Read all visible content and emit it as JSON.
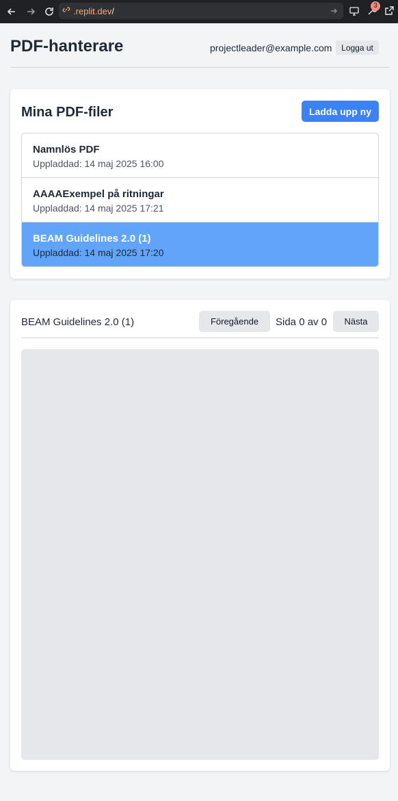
{
  "browser": {
    "url_domain": ".replit.dev",
    "url_path": "/",
    "extensions_badge": "3",
    "icons": [
      "back-arrow-icon",
      "forward-arrow-icon",
      "reload-icon",
      "link-icon",
      "go-arrow-icon",
      "monitor-icon",
      "wrench-icon",
      "external-link-icon"
    ]
  },
  "header": {
    "title": "PDF-hanterare",
    "user_email": "projectleader@example.com",
    "logout_label": "Logga ut"
  },
  "files_card": {
    "title": "Mina PDF-filer",
    "upload_label": "Ladda upp ny",
    "files": [
      {
        "name": "Namnlös PDF",
        "uploaded": "Uppladdad: 14 maj 2025 16:00",
        "selected": false
      },
      {
        "name": "AAAAExempel på ritningar",
        "uploaded": "Uppladdad: 14 maj 2025 17:21",
        "selected": false
      },
      {
        "name": "BEAM Guidelines 2.0 (1)",
        "uploaded": "Uppladdad: 14 maj 2025 17:20",
        "selected": true
      }
    ]
  },
  "viewer": {
    "title": "BEAM Guidelines 2.0 (1)",
    "prev_label": "Föregående",
    "page_indicator": "Sida 0 av 0",
    "next_label": "Nästa"
  },
  "colors": {
    "accent": "#3b82f6",
    "selected_row": "#60a5fa",
    "page_bg": "#f3f4f6",
    "chrome_bg": "#202124"
  }
}
